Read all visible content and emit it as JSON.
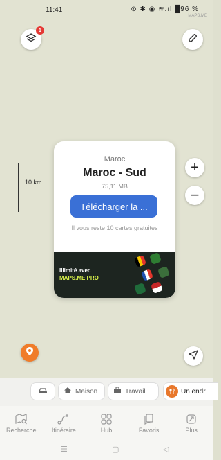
{
  "status_bar": {
    "time": "11:41",
    "indicators": "⊙ ✱ ◉ ≋.ıl █96 %",
    "watermark": "MAPS.ME"
  },
  "map": {
    "layers_badge": "1",
    "scale_label": "10 km"
  },
  "card": {
    "country": "Maroc",
    "region": "Maroc - Sud",
    "size": "75,11 MB",
    "download_button": "Télécharger la ...",
    "info": "Il vous reste 10 cartes gratuites",
    "promo_line1": "Illimité avec",
    "promo_line2": "MAPS.ME PRO"
  },
  "zoom": {
    "in_label": "+",
    "out_label": "−"
  },
  "chips": {
    "home": "Maison",
    "work": "Travail",
    "custom": "Un endr"
  },
  "bottom_nav": {
    "items": [
      {
        "label": "Recherche",
        "icon": "map-search-icon"
      },
      {
        "label": "Itinéraire",
        "icon": "route-icon"
      },
      {
        "label": "Hub",
        "icon": "grid-icon"
      },
      {
        "label": "Favoris",
        "icon": "bookmark-icon"
      },
      {
        "label": "Plus",
        "icon": "more-icon"
      }
    ]
  },
  "colors": {
    "accent": "#3a70d6",
    "badge": "#e53935",
    "orange": "#f07c2a",
    "map_bg": "#e2e3d2"
  }
}
